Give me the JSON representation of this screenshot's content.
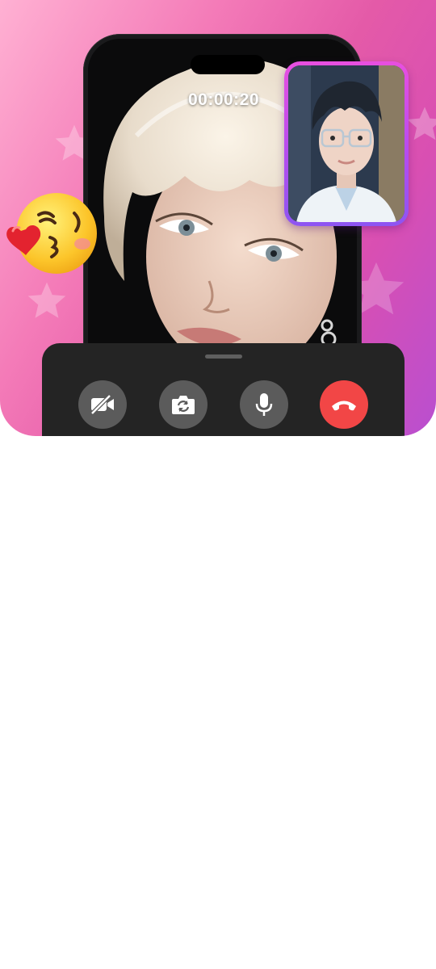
{
  "call": {
    "timer": "00:00:20"
  },
  "controls": [
    {
      "name": "camera-off-button",
      "icon": "video-off-icon"
    },
    {
      "name": "switch-camera-button",
      "icon": "camera-flip-icon"
    },
    {
      "name": "microphone-button",
      "icon": "microphone-icon"
    },
    {
      "name": "end-call-button",
      "icon": "phone-hangup-icon"
    }
  ],
  "colors": {
    "accent_pink": "#e45aa8",
    "accent_purple": "#b64cf0",
    "panel": "#242424",
    "control": "#5b5b5b",
    "end_call": "#f24646"
  }
}
